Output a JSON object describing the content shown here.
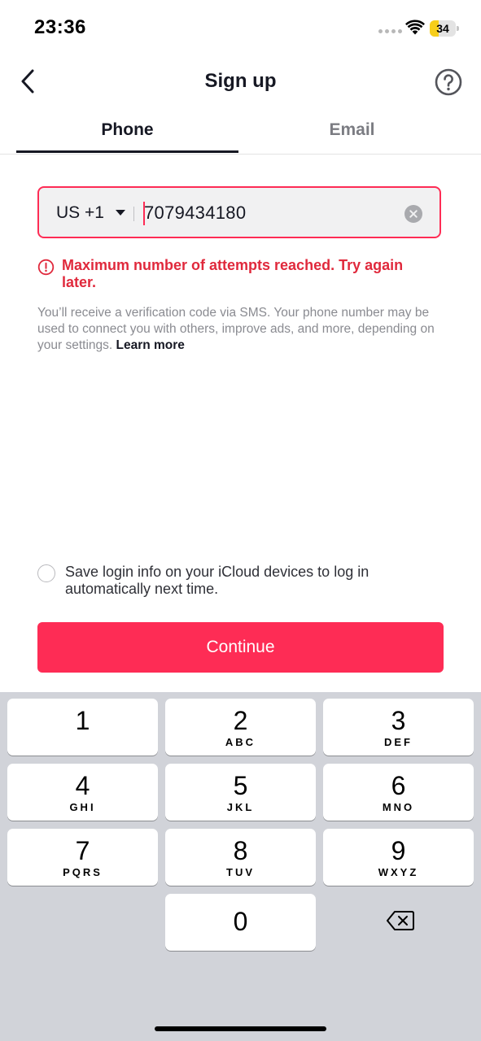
{
  "status_bar": {
    "time": "23:36",
    "battery_level": "34",
    "battery_percent": 34
  },
  "nav": {
    "title": "Sign up"
  },
  "tabs": [
    {
      "label": "Phone",
      "active": true
    },
    {
      "label": "Email",
      "active": false
    }
  ],
  "phone_field": {
    "country_code": "US +1",
    "value": "7079434180"
  },
  "error": {
    "message": "Maximum number of attempts reached. Try again later."
  },
  "info": {
    "text": "You’ll receive a verification code via SMS. Your phone number may be used to connect you with others, improve ads, and more, depending on your settings.",
    "link": "Learn more"
  },
  "save_login": {
    "label": "Save login info on your iCloud devices to log in automatically next time.",
    "checked": false
  },
  "continue_button": {
    "label": "Continue"
  },
  "keyboard": {
    "keys": [
      {
        "digit": "1",
        "letters": ""
      },
      {
        "digit": "2",
        "letters": "ABC"
      },
      {
        "digit": "3",
        "letters": "DEF"
      },
      {
        "digit": "4",
        "letters": "GHI"
      },
      {
        "digit": "5",
        "letters": "JKL"
      },
      {
        "digit": "6",
        "letters": "MNO"
      },
      {
        "digit": "7",
        "letters": "PQRS"
      },
      {
        "digit": "8",
        "letters": "TUV"
      },
      {
        "digit": "9",
        "letters": "WXYZ"
      },
      {
        "digit": "0",
        "letters": ""
      }
    ]
  },
  "colors": {
    "accent": "#fe2c55",
    "error": "#e0293c",
    "keyboard_bg": "#d1d3d9",
    "battery_fill": "#f7ce1b"
  },
  "icons": {
    "back": "chevron-left-icon",
    "help": "question-circle-icon",
    "clear": "clear-circle-icon",
    "error": "info-circle-icon",
    "backspace": "backspace-icon"
  }
}
